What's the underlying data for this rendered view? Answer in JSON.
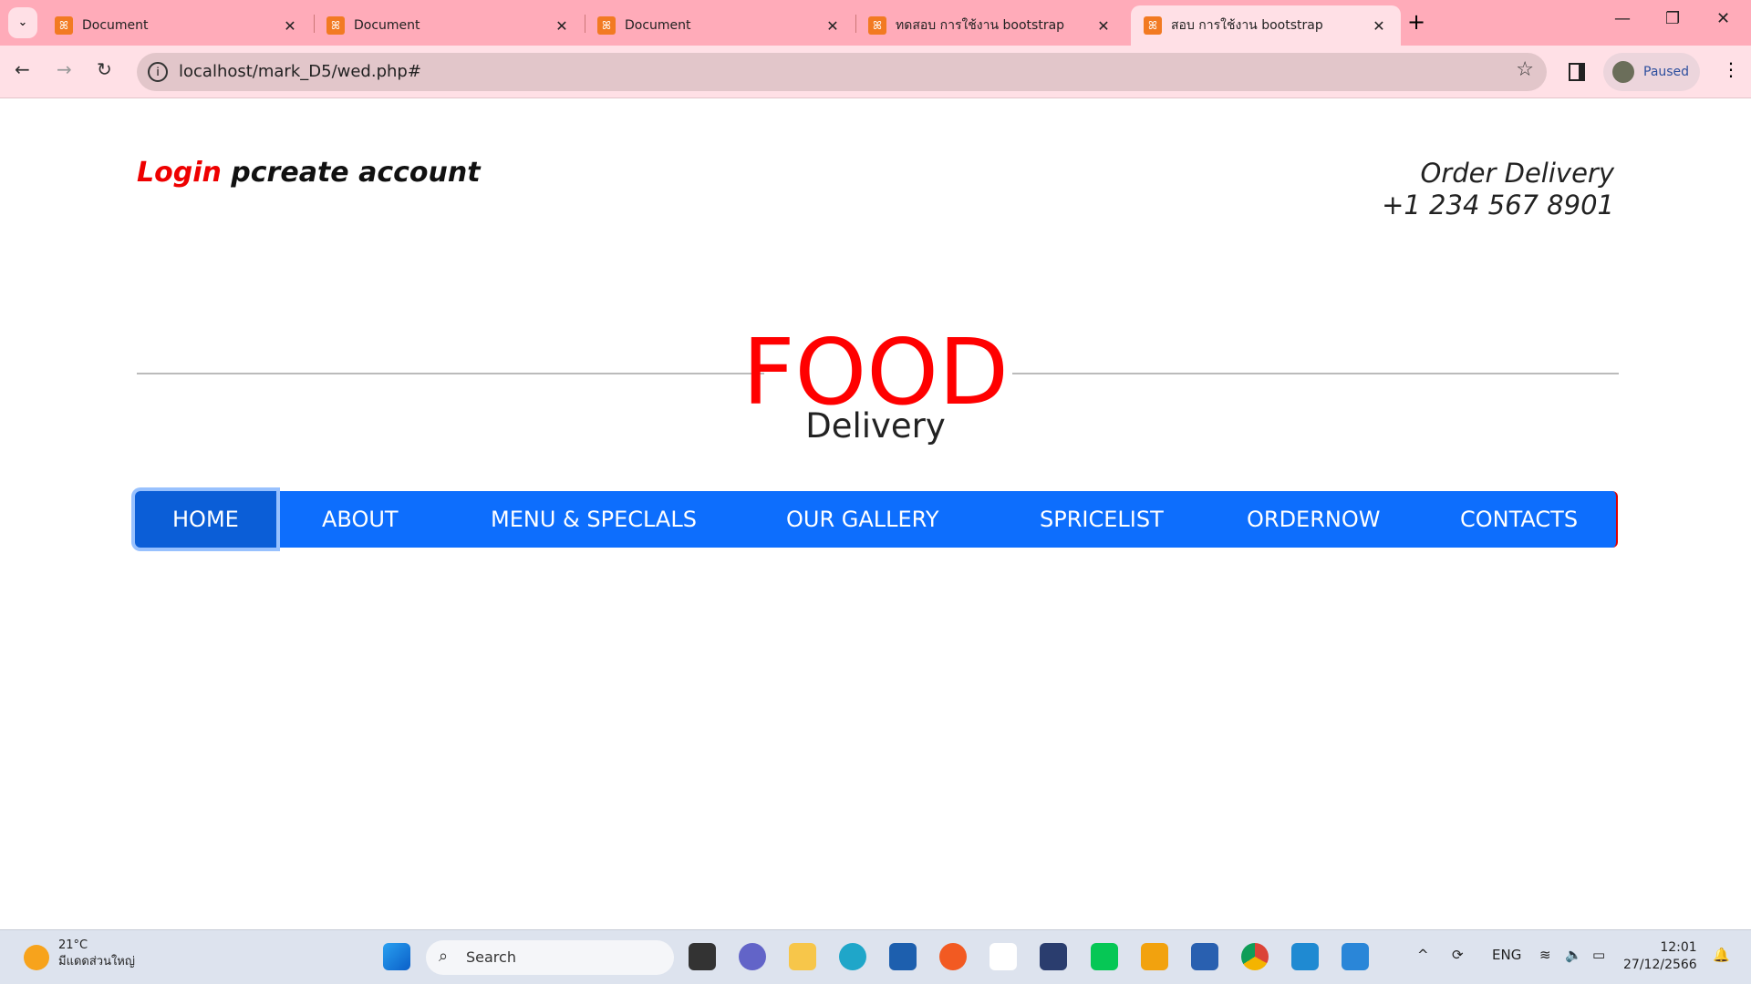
{
  "browser": {
    "tabs": [
      {
        "title": "Document",
        "active": false
      },
      {
        "title": "Document",
        "active": false
      },
      {
        "title": "Document",
        "active": false
      },
      {
        "title": "ทดสอบ การใช้งาน bootstrap",
        "active": false
      },
      {
        "title": "สอบ การใช้งาน bootstrap",
        "active": true
      }
    ],
    "url": "localhost/mark_D5/wed.php#",
    "profile_status": "Paused"
  },
  "page": {
    "login": "Login",
    "create_account": "pcreate account",
    "order_line1": "Order Delivery",
    "order_phone": "+1 234 567 8901",
    "brand": "FOOD",
    "tagline": "Delivery",
    "nav": [
      "HOME",
      "ABOUT",
      "MENU & SPECLALS",
      "OUR GALLERY",
      "SPRICELIST",
      "ORDERNOW",
      "CONTACTS"
    ],
    "active_nav": "HOME"
  },
  "colors": {
    "brand_red": "#ff0000",
    "nav_blue": "#0d6efd",
    "nav_active": "#0b5ed7",
    "tab_bar": "#ffabb9"
  },
  "taskbar": {
    "temperature": "21°C",
    "weather_desc": "มีแดดส่วนใหญ่",
    "search_placeholder": "Search",
    "language": "ENG",
    "time": "12:01",
    "date": "27/12/2566"
  }
}
